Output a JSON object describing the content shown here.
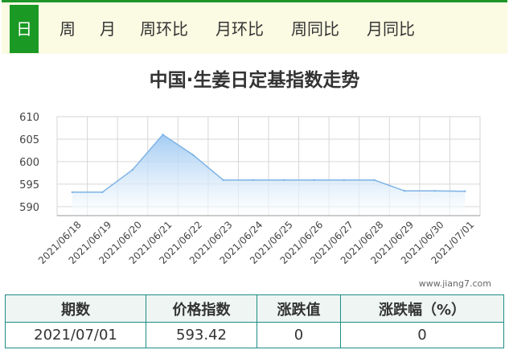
{
  "tabs": [
    {
      "label": "日",
      "active": true
    },
    {
      "label": "周",
      "active": false
    },
    {
      "label": "月",
      "active": false
    },
    {
      "label": "周环比",
      "active": false
    },
    {
      "label": "月环比",
      "active": false
    },
    {
      "label": "周同比",
      "active": false
    },
    {
      "label": "月同比",
      "active": false
    }
  ],
  "colors": {
    "tab_active_bg": "#1a9a24",
    "tabbar_bg": "#fbfbe3",
    "series_line": "#7db3e6",
    "series_fill_top": "#9ec9f2",
    "table_border": "#1e8d86"
  },
  "chart_title": "中国·生姜日定基指数走势",
  "chart_data": {
    "type": "area",
    "title": "中国·生姜日定基指数走势",
    "xlabel": "",
    "ylabel": "",
    "x": [
      "2021/06/18",
      "2021/06/19",
      "2021/06/20",
      "2021/06/21",
      "2021/06/22",
      "2021/06/23",
      "2021/06/24",
      "2021/06/25",
      "2021/06/26",
      "2021/06/27",
      "2021/06/28",
      "2021/06/29",
      "2021/06/30",
      "2021/07/01"
    ],
    "series": [
      {
        "values": [
          593.2,
          593.2,
          598.2,
          606.0,
          601.5,
          595.9,
          595.9,
          595.9,
          595.9,
          595.9,
          595.9,
          593.5,
          593.5,
          593.42
        ]
      }
    ],
    "yticks": [
      590,
      595,
      600,
      605,
      610
    ],
    "ylim": [
      588,
      610
    ],
    "grid": true,
    "legend": "none"
  },
  "watermark": "www.jiang7.com",
  "table": {
    "headers": [
      "期数",
      "价格指数",
      "涨跌值",
      "涨跌幅（%）"
    ],
    "rows": [
      [
        "2021/07/01",
        "593.42",
        "0",
        "0"
      ]
    ]
  }
}
